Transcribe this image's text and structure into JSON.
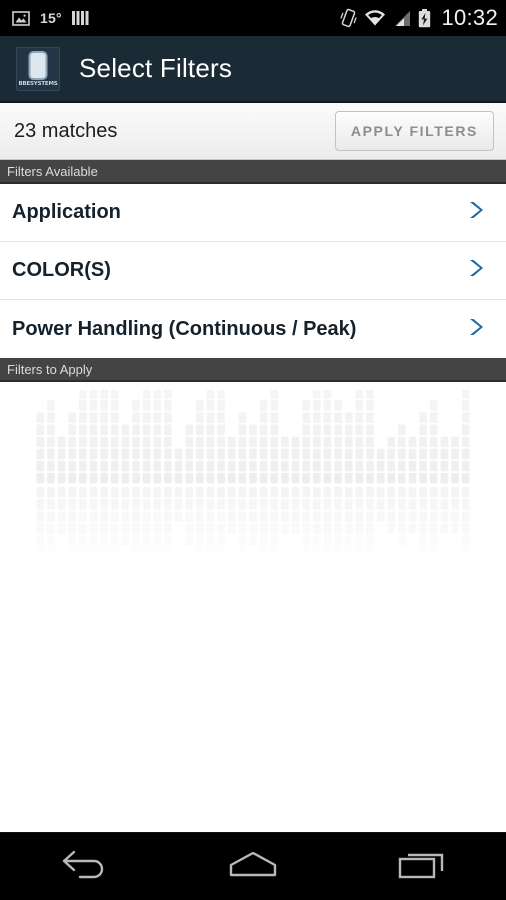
{
  "statusbar": {
    "gallery_icon": "photo-icon",
    "temperature": "15°",
    "bars_icon": "signal-bars-icon",
    "vibrate_icon": "vibrate-icon",
    "wifi_icon": "wifi-icon",
    "cellular_icon": "cellular-signal-icon",
    "battery_icon": "battery-charging-icon",
    "clock": "10:32"
  },
  "actionbar": {
    "logo_name": "bbe-systems-logo",
    "logo_brand": "BBESYSTEMS",
    "title": "Select Filters",
    "bg_color": "#1b2b36"
  },
  "matchbar": {
    "count_text": "23 matches",
    "apply_label": "APPLY FILTERS"
  },
  "sections": {
    "available_header": "Filters Available",
    "to_apply_header": "Filters to Apply"
  },
  "filters_available": [
    {
      "label": "Application",
      "chevron": "chevron-right-icon"
    },
    {
      "label": "COLOR(S)",
      "chevron": "chevron-right-icon"
    },
    {
      "label": "Power Handling (Continuous / Peak)",
      "chevron": "chevron-right-icon"
    }
  ],
  "filters_to_apply": [],
  "watermark": {
    "name": "equalizer-watermark",
    "block_color": "#e9ecee",
    "columns": [
      6,
      7,
      4,
      6,
      9,
      8,
      8,
      12,
      5,
      7,
      8,
      9,
      10,
      3,
      5,
      7,
      11,
      9,
      4,
      6,
      5,
      7,
      9,
      4,
      4,
      7,
      9,
      9,
      7,
      6,
      8,
      9,
      3,
      4,
      5,
      4,
      6,
      7,
      4,
      4,
      13
    ]
  },
  "navbar": {
    "back": "back-arrow-icon",
    "home": "home-icon",
    "recents": "recent-apps-icon"
  },
  "colors": {
    "accent_blue": "#1f6aa5",
    "header_gray": "#444444",
    "page_bg": "#ffffff"
  }
}
